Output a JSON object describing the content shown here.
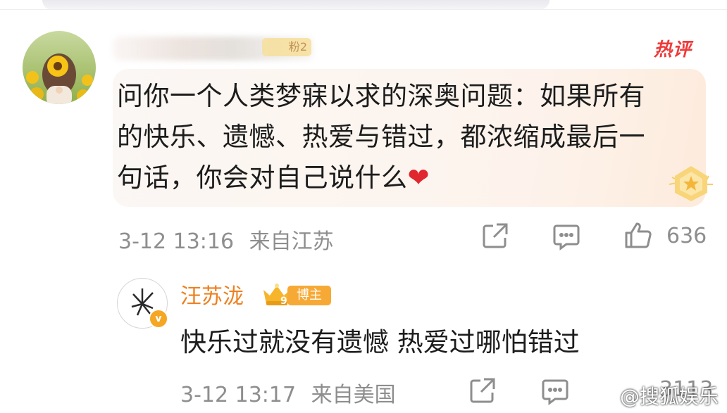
{
  "comment": {
    "fan_badge": "粉2",
    "hot_label": "热评",
    "text_lines": [
      "问你一个人类梦寐以求的深奥问题：如果所有",
      "的快乐、遗憾、热爱与错过，都浓缩成最后一",
      "句话，你会对自己说什么"
    ],
    "heart": "❤",
    "time": "3-12 13:16",
    "location": "来自江苏",
    "like_count": "636"
  },
  "reply": {
    "username": "汪苏泷",
    "verify_mark": "v",
    "level": "9",
    "badge": "博主",
    "text": "快乐过就没有遗憾 热爱过哪怕错过",
    "time": "3-12 13:17",
    "location": "来自美国",
    "like_count": "3113"
  },
  "watermark": "@搜狐娱乐",
  "colors": {
    "hot_red": "#ee3b3b",
    "reply_name": "#ee8020",
    "badge_orange": "#f7a935",
    "meta_gray": "#8e8e8e"
  },
  "icons": [
    "share-icon",
    "comment-icon",
    "like-icon",
    "star-medal-icon",
    "crown-icon"
  ]
}
